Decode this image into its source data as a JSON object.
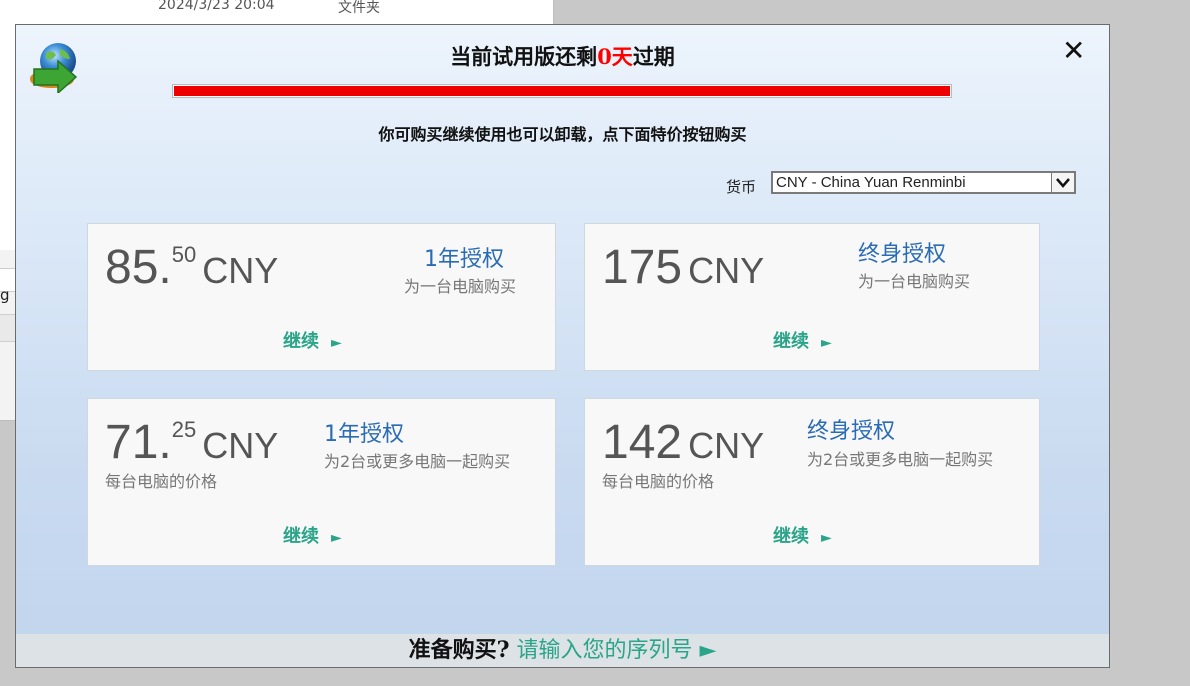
{
  "background": {
    "date": "2024/3/23 20:04",
    "type": "文件夹",
    "partial": "g"
  },
  "dialog": {
    "title_prefix": "当前试用版还剩",
    "days": "0天",
    "title_suffix": "过期",
    "trial_remaining_fraction": 1.0,
    "subtitle": "你可购买继续使用也可以卸载，点下面特价按钮购买",
    "currency_label": "货币",
    "currency_value": "CNY  - China Yuan Renminbi",
    "colors": {
      "accent_red": "#ee0000",
      "link_blue": "#2a6bb5",
      "continue_green": "#2ba58a"
    }
  },
  "cards": [
    {
      "price_int": "85.",
      "price_cents": "50",
      "currency": "CNY",
      "license": "1年授权",
      "license_sub": "为一台电脑购买",
      "per_pc": "",
      "continue": "继续"
    },
    {
      "price_int": "175",
      "price_cents": "",
      "currency": "CNY",
      "license": "终身授权",
      "license_sub": "为一台电脑购买",
      "per_pc": "",
      "continue": "继续"
    },
    {
      "price_int": "71.",
      "price_cents": "25",
      "currency": "CNY",
      "license": "1年授权",
      "license_sub": "为2台或更多电脑一起购买",
      "per_pc": "每台电脑的价格",
      "continue": "继续"
    },
    {
      "price_int": "142",
      "price_cents": "",
      "currency": "CNY",
      "license": "终身授权",
      "license_sub": "为2台或更多电脑一起购买",
      "per_pc": "每台电脑的价格",
      "continue": "继续"
    }
  ],
  "footer": {
    "question": "准备购买?",
    "link": "请输入您的序列号 ►"
  },
  "icons": {
    "close": "close-icon",
    "logo": "idm-globe-logo",
    "continue": "play-triangle-icon",
    "dropdown": "chevron-down-icon"
  }
}
